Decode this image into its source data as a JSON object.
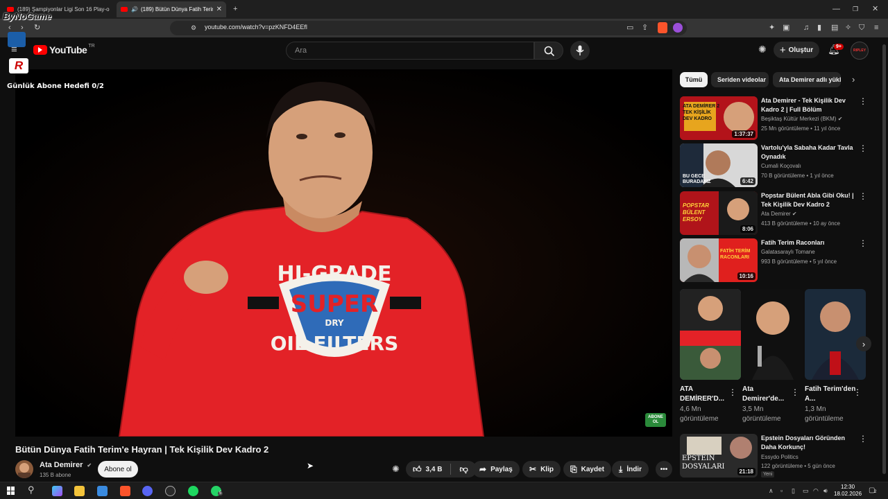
{
  "browser": {
    "tabs": [
      {
        "label": "(189) Şampiyonlar Ligi Son 16 Play-o"
      },
      {
        "label": "(189) Bütün Dünya Fatih Terim"
      }
    ],
    "url": "youtube.com/watch?v=pzKNFD4EEfl"
  },
  "overlay": {
    "watermark": "ByNoGame",
    "goal_text": "Günlük Abone Hedefi 0/2",
    "abone_badge": "ABONE OL"
  },
  "header": {
    "logo_text": "YouTube",
    "region": "TR",
    "search_placeholder": "Ara",
    "create_label": "Oluştur",
    "notification_count": "9+",
    "avatar_text": "RIPLEY"
  },
  "video": {
    "title": "Bütün Dünya Fatih Terim'e Hayran | Tek Kişilik Dev Kadro 2",
    "channel": "Ata Demirer",
    "subscribers": "135 B abone",
    "subscribe_label": "Abone ol",
    "likes": "3,4 B",
    "share_label": "Paylaş",
    "clip_label": "Klip",
    "save_label": "Kaydet",
    "download_label": "İndir",
    "shirt_lines": [
      "HI-GRADE",
      "SUPER",
      "DRY",
      "OIL FILTERS"
    ]
  },
  "sidebar": {
    "chips": [
      "Tümü",
      "Seriden videolar",
      "Ata Demirer adlı yükle"
    ],
    "recommendations": [
      {
        "title": "Ata Demirer - Tek Kişilik Dev Kadro 2 | Full Bölüm",
        "channel": "Beşiktaş Kültür Merkezi (BKM)",
        "meta": "25 Mn görüntüleme • 11 yıl önce",
        "duration": "1:37:37",
        "thumb_text": "ATA DEMİRER 2 TEK KİŞİLİK DEV KADRO",
        "thumb_color": "#c2121a"
      },
      {
        "title": "Vartolu'yla Sabaha Kadar Tavla Oynadık",
        "channel": "Cumali Koçovalı",
        "meta": "70 B görüntüleme • 1 yıl önce",
        "duration": "6:42",
        "thumb_text": "BU GECE BURADAYIZ",
        "thumb_color": "#d8d8d8"
      },
      {
        "title": "Popstar Bülent Abla Gibi Oku! | Tek Kişilik Dev Kadro 2",
        "channel": "Ata Demirer",
        "meta": "413 B görüntüleme • 10 ay önce",
        "duration": "8:06",
        "thumb_text": "POPSTAR BÜLENT ERSOY",
        "thumb_color": "#b0141a"
      },
      {
        "title": "Fatih Terim Raconları",
        "channel": "Galatasaraylı Tomane",
        "meta": "993 B görüntüleme • 5 yıl önce",
        "duration": "10:16",
        "thumb_text": "FATİH TERİM RACONLARI",
        "thumb_color": "#e0201e"
      },
      {
        "title": "Epstein Dosyaları Göründen Daha Korkunç!",
        "channel": "Essydo Politics",
        "meta": "122 görüntüleme • 5 gün önce",
        "duration": "21:18",
        "badge": "Yeni",
        "thumb_text": "EPSTEIN DOSYALARI",
        "thumb_color": "#2a2a2a"
      }
    ],
    "shorts": [
      {
        "title": "ATA DEMİRER'D...",
        "views": "4,6 Mn görüntüleme"
      },
      {
        "title": "Ata Demirer'de...",
        "views": "3,5 Mn görüntüleme"
      },
      {
        "title": "Fatih Terim'den A...",
        "views": "1,3 Mn görüntüleme"
      }
    ]
  },
  "taskbar": {
    "time": "12:30",
    "date": "18.02.2026",
    "whatsapp_badge": "5",
    "notif_badge": "2"
  },
  "colors": {
    "yt_red": "#ff0000",
    "bg": "#0f0f0f",
    "shirt": "#e32227"
  }
}
